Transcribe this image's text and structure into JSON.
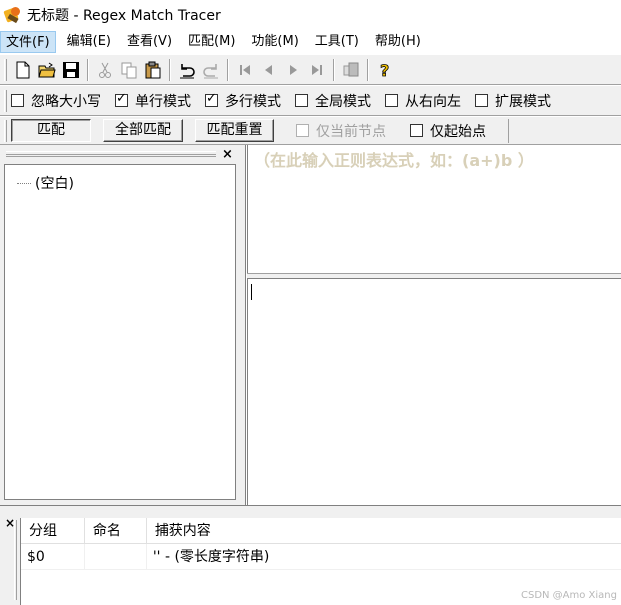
{
  "window": {
    "title": "无标题 - Regex Match Tracer"
  },
  "menubar": {
    "items": [
      {
        "label": "文件(F)",
        "active": true
      },
      {
        "label": "编辑(E)"
      },
      {
        "label": "查看(V)"
      },
      {
        "label": "匹配(M)"
      },
      {
        "label": "功能(M)"
      },
      {
        "label": "工具(T)"
      },
      {
        "label": "帮助(H)"
      }
    ]
  },
  "toolbar": {
    "icons": [
      "new-file-icon",
      "open-folder-icon",
      "save-icon",
      "cut-icon",
      "copy-icon",
      "paste-icon",
      "undo-icon",
      "redo-icon",
      "first-icon",
      "previous-icon",
      "next-icon",
      "last-icon",
      "copy-result-icon",
      "help-icon"
    ]
  },
  "options": {
    "ignore_case": {
      "label": "忽略大小写",
      "checked": false
    },
    "single_line": {
      "label": "单行模式",
      "checked": true
    },
    "multi_line": {
      "label": "多行模式",
      "checked": true
    },
    "global": {
      "label": "全局模式",
      "checked": false
    },
    "right_to_left": {
      "label": "从右向左",
      "checked": false
    },
    "extended": {
      "label": "扩展模式",
      "checked": false
    }
  },
  "actions": {
    "match": "匹配",
    "match_all": "全部匹配",
    "match_reset": "匹配重置",
    "current_node_only": "仅当前节点",
    "start_point_only": "仅起始点"
  },
  "tree": {
    "node": "(空白)"
  },
  "regex_input": {
    "placeholder": "（在此输入正则表达式，如：(a+)b ）"
  },
  "results": {
    "columns": [
      "分组",
      "命名",
      "捕获内容"
    ],
    "rows": [
      {
        "group": "$0",
        "name": "",
        "content": "'' - (零长度字符串)"
      }
    ]
  },
  "watermark": "CSDN @Amo Xiang"
}
